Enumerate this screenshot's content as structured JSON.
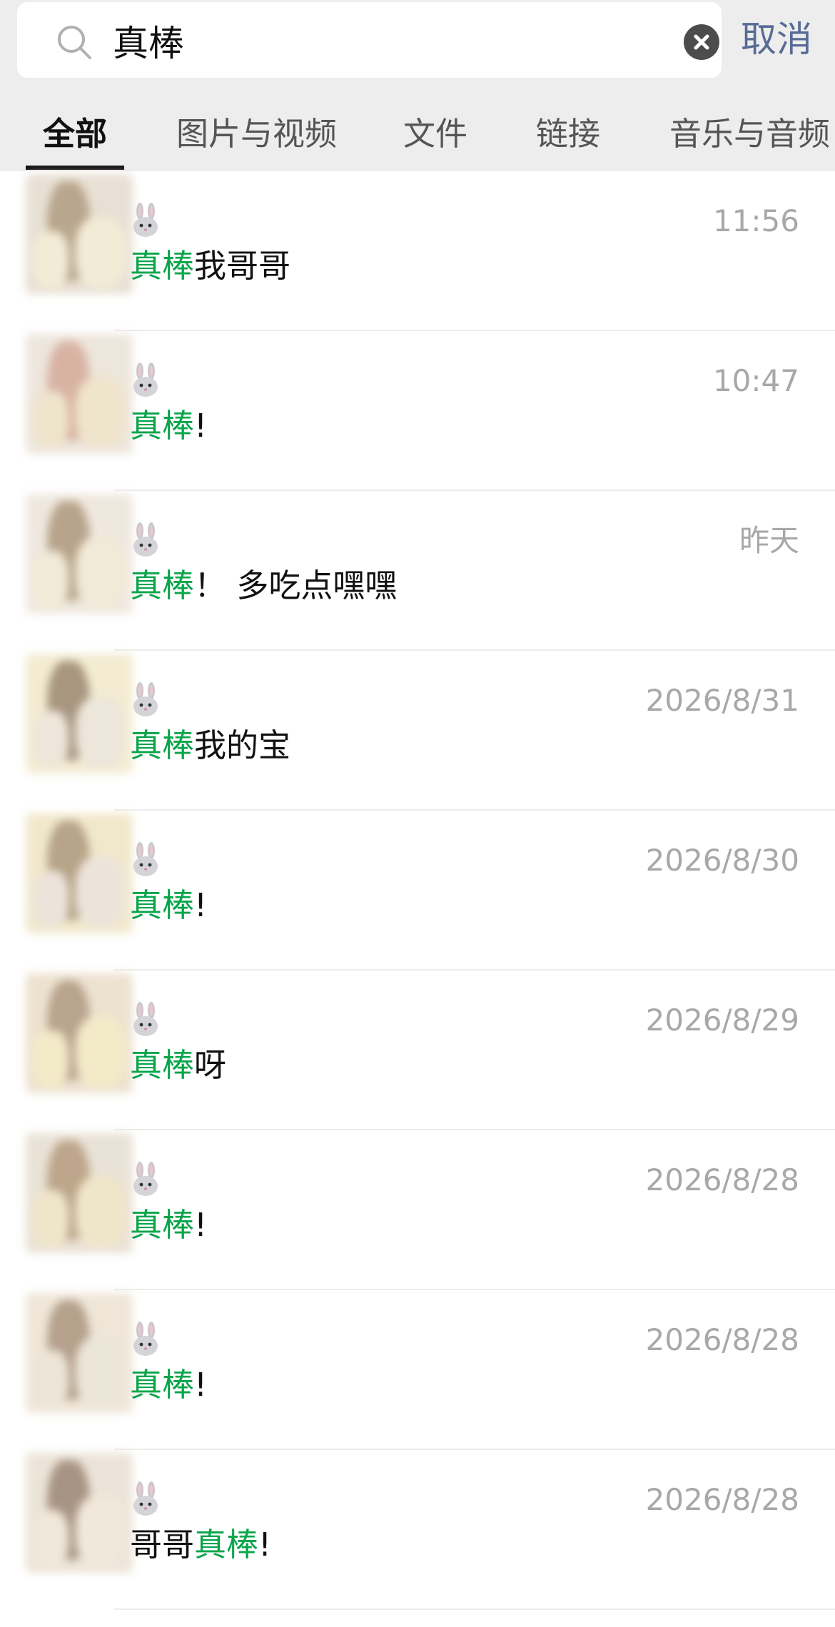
{
  "search": {
    "value": "真棒",
    "cancel_label": "取消"
  },
  "tabs": [
    {
      "label": "全部",
      "active": true
    },
    {
      "label": "图片与视频",
      "active": false
    },
    {
      "label": "文件",
      "active": false
    },
    {
      "label": "链接",
      "active": false
    },
    {
      "label": "音乐与音频",
      "active": false
    }
  ],
  "results": [
    {
      "time": "11:56",
      "before": "",
      "highlight": "真棒",
      "after": "我哥哥"
    },
    {
      "time": "10:47",
      "before": "",
      "highlight": "真棒",
      "after": "!"
    },
    {
      "time": "昨天",
      "before": "",
      "highlight": "真棒",
      "after": "！ 多吃点嘿嘿"
    },
    {
      "time": "2026/8/31",
      "before": "",
      "highlight": "真棒",
      "after": "我的宝"
    },
    {
      "time": "2026/8/30",
      "before": "",
      "highlight": "真棒",
      "after": "!"
    },
    {
      "time": "2026/8/29",
      "before": "",
      "highlight": "真棒",
      "after": "呀"
    },
    {
      "time": "2026/8/28",
      "before": "",
      "highlight": "真棒",
      "after": "!"
    },
    {
      "time": "2026/8/28",
      "before": "",
      "highlight": "真棒",
      "after": "!"
    },
    {
      "time": "2026/8/28",
      "before": "哥哥",
      "highlight": "真棒",
      "after": "!"
    }
  ],
  "colors": {
    "highlight": "#07a54a",
    "cancel": "#576b95",
    "time": "#a8a8a8"
  },
  "icons": {
    "search": "search-icon",
    "clear": "clear-icon",
    "rabbit": "rabbit-icon"
  }
}
